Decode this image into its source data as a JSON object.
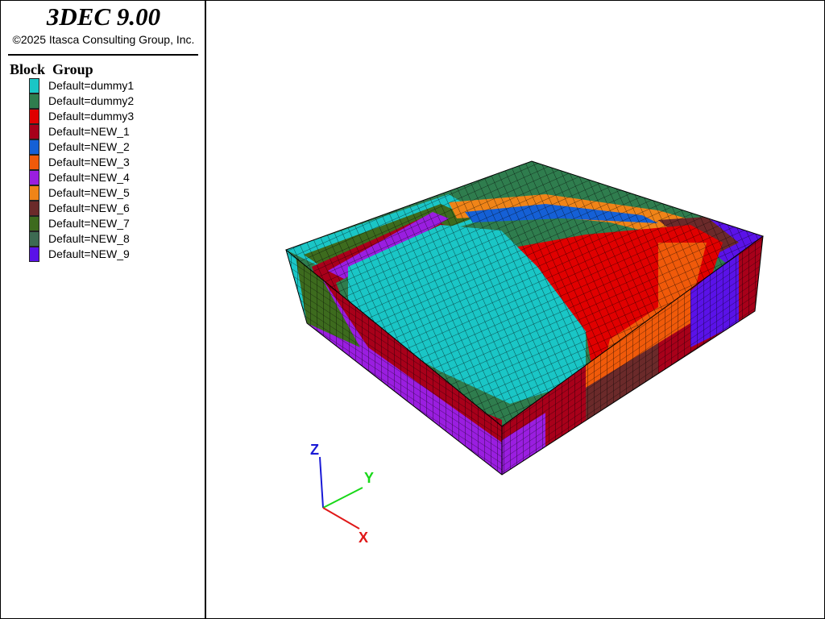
{
  "app": {
    "title": "3DEC 9.00",
    "copyright": "©2025 Itasca Consulting Group, Inc."
  },
  "legend": {
    "title": "Block  Group",
    "items": [
      {
        "label": "Default=dummy1",
        "color": "#1ac6c6"
      },
      {
        "label": "Default=dummy2",
        "color": "#2f7d4e"
      },
      {
        "label": "Default=dummy3",
        "color": "#e00000"
      },
      {
        "label": "Default=NEW_1",
        "color": "#a8001a"
      },
      {
        "label": "Default=NEW_2",
        "color": "#1560d6"
      },
      {
        "label": "Default=NEW_3",
        "color": "#f05a0a"
      },
      {
        "label": "Default=NEW_4",
        "color": "#9a1ee0"
      },
      {
        "label": "Default=NEW_5",
        "color": "#f08418"
      },
      {
        "label": "Default=NEW_6",
        "color": "#6b2a2a"
      },
      {
        "label": "Default=NEW_7",
        "color": "#3d6b1e"
      },
      {
        "label": "Default=NEW_8",
        "color": "#3d6a52"
      },
      {
        "label": "Default=NEW_9",
        "color": "#5a12e8"
      }
    ]
  },
  "axes": {
    "z_label": "Z",
    "y_label": "Y",
    "x_label": "X",
    "z_color": "#1a1ad6",
    "y_color": "#18d818",
    "x_color": "#e01818"
  }
}
